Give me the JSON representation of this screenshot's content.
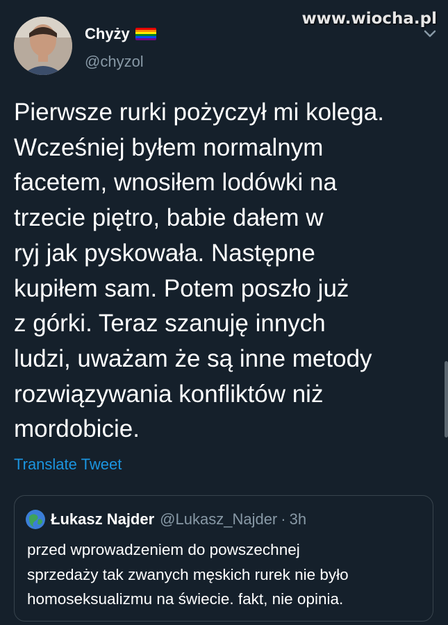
{
  "watermark": "www.wiocha.pl",
  "author": {
    "display_name": "Chyży",
    "handle": "@chyzol",
    "flag_colors": [
      "#e40303",
      "#ff8c00",
      "#ffed00",
      "#008026",
      "#004dff",
      "#750787"
    ]
  },
  "tweet": {
    "lines": [
      "Pierwsze rurki pożyczył mi kolega.",
      "Wcześniej byłem normalnym",
      "facetem, wnosiłem lodówki na",
      "trzecie piętro, babie dałem w",
      "ryj jak pyskowała. Następne",
      "kupiłem sam. Potem poszło już",
      "z górki. Teraz szanuję innych",
      "ludzi, uważam że są inne metody",
      "rozwiązywania konfliktów niż",
      "mordobicie."
    ],
    "translate_label": "Translate Tweet"
  },
  "quoted": {
    "display_name": "Łukasz Najder",
    "handle": "@Lukasz_Najder",
    "separator": "·",
    "time": "3h",
    "lines": [
      "przed wprowadzeniem do powszechnej",
      "sprzedaży tak zwanych męskich rurek nie było",
      "homoseksualizmu na świecie. fakt, nie opinia."
    ]
  },
  "colors": {
    "background": "#15202b",
    "link": "#1b95e0",
    "secondary_text": "#8899a6",
    "border": "#38444d"
  }
}
